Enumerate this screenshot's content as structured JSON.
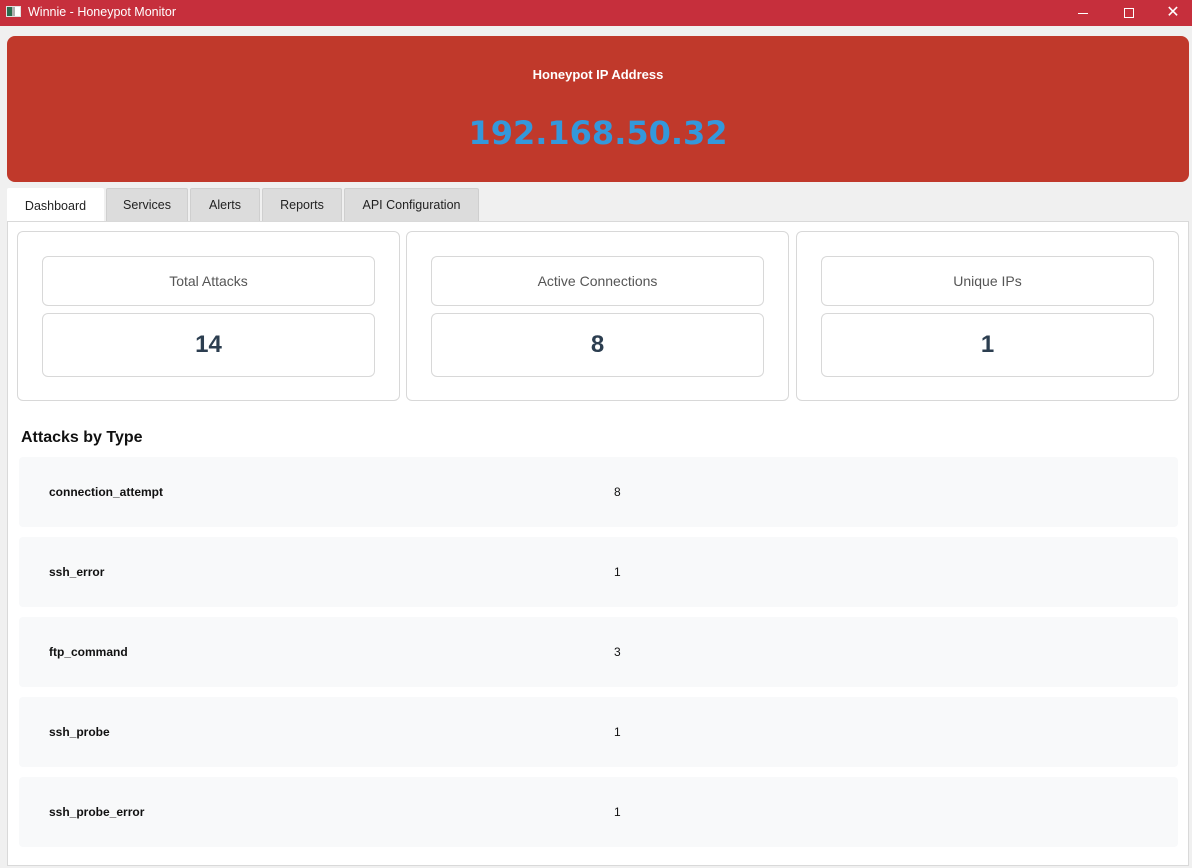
{
  "window": {
    "title": "Winnie - Honeypot Monitor",
    "controls": {
      "minimize": "minimize",
      "maximize": "maximize",
      "close": "✕"
    },
    "titlebar_color": "#c62f3c"
  },
  "banner": {
    "label": "Honeypot IP Address",
    "ip": "192.168.50.32",
    "background_color": "#c0392b",
    "ip_color": "#3498db"
  },
  "tabs": [
    {
      "label": "Dashboard",
      "active": true
    },
    {
      "label": "Services",
      "active": false
    },
    {
      "label": "Alerts",
      "active": false
    },
    {
      "label": "Reports",
      "active": false
    },
    {
      "label": "API Configuration",
      "active": false
    }
  ],
  "stats": [
    {
      "label": "Total Attacks",
      "value": "14"
    },
    {
      "label": "Active Connections",
      "value": "8"
    },
    {
      "label": "Unique IPs",
      "value": "1"
    }
  ],
  "attacks_by_type": {
    "title": "Attacks by Type",
    "rows": [
      {
        "type": "connection_attempt",
        "count": "8"
      },
      {
        "type": "ssh_error",
        "count": "1"
      },
      {
        "type": "ftp_command",
        "count": "3"
      },
      {
        "type": "ssh_probe",
        "count": "1"
      },
      {
        "type": "ssh_probe_error",
        "count": "1"
      }
    ]
  }
}
